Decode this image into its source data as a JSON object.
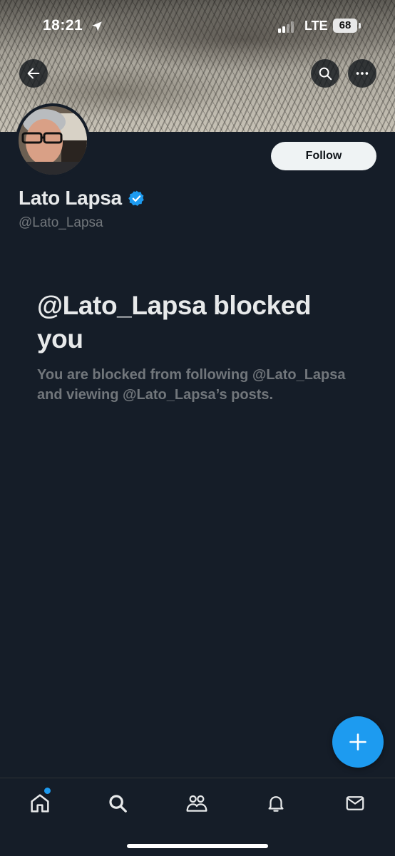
{
  "status_bar": {
    "time": "18:21",
    "network": "LTE",
    "battery": "68"
  },
  "header": {
    "icons": [
      "back-arrow-icon",
      "search-icon",
      "more-icon"
    ]
  },
  "profile": {
    "display_name": "Lato Lapsa",
    "handle": "@Lato_Lapsa",
    "verified": true,
    "follow_label": "Follow"
  },
  "blocked": {
    "title": "@Lato_Lapsa blocked you",
    "description": "You are blocked from following @Lato_Lapsa and viewing @Lato_Lapsa’s posts."
  },
  "fab": {
    "icon": "plus-icon"
  },
  "tab_bar": {
    "items": [
      "home-icon",
      "search-icon",
      "communities-icon",
      "notifications-icon",
      "messages-icon"
    ],
    "home_has_notification": true
  },
  "colors": {
    "background": "#151d28",
    "accent": "#1d9bf0",
    "text_primary": "#e7e9ea",
    "text_secondary": "#71767b"
  }
}
